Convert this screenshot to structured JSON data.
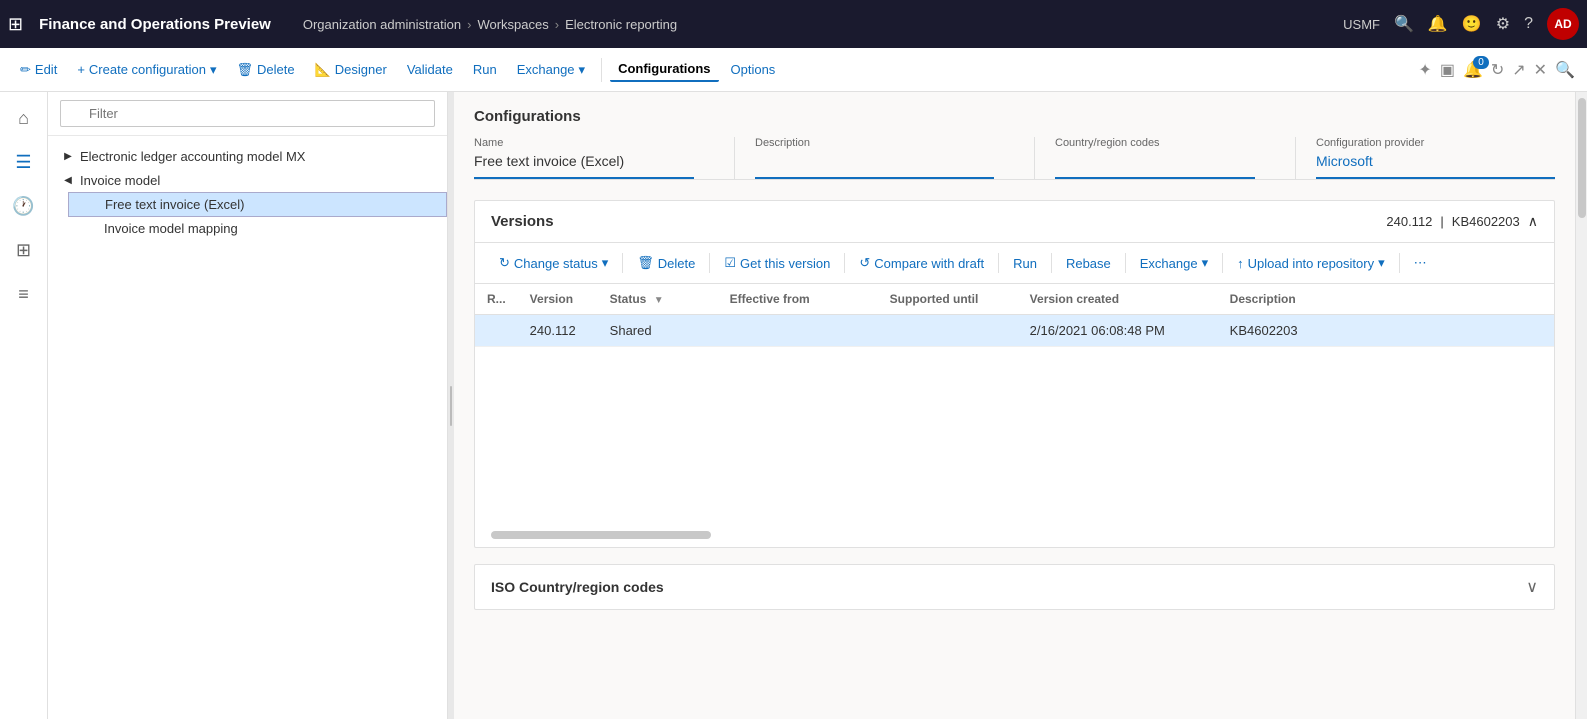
{
  "app": {
    "title": "Finance and Operations Preview",
    "tenant": "USMF",
    "avatar": "AD"
  },
  "breadcrumb": {
    "items": [
      "Organization administration",
      "Workspaces",
      "Electronic reporting"
    ]
  },
  "toolbar": {
    "buttons": [
      {
        "id": "edit",
        "label": "Edit",
        "icon": "✏️"
      },
      {
        "id": "create-config",
        "label": "Create configuration",
        "icon": "+",
        "dropdown": true
      },
      {
        "id": "delete",
        "label": "Delete",
        "icon": "🗑"
      },
      {
        "id": "designer",
        "label": "Designer",
        "icon": "📐"
      },
      {
        "id": "validate",
        "label": "Validate"
      },
      {
        "id": "run",
        "label": "Run"
      },
      {
        "id": "exchange",
        "label": "Exchange",
        "dropdown": true
      },
      {
        "id": "configurations",
        "label": "Configurations",
        "active": true
      },
      {
        "id": "options",
        "label": "Options"
      }
    ]
  },
  "filter": {
    "placeholder": "Filter"
  },
  "tree": {
    "items": [
      {
        "id": "electronic-ledger",
        "label": "Electronic ledger accounting model MX",
        "indent": 0,
        "collapsed": true
      },
      {
        "id": "invoice-model",
        "label": "Invoice model",
        "indent": 0,
        "expanded": true
      },
      {
        "id": "free-text-excel",
        "label": "Free text invoice (Excel)",
        "indent": 1,
        "selected": true
      },
      {
        "id": "invoice-model-mapping",
        "label": "Invoice model mapping",
        "indent": 1
      }
    ]
  },
  "configurations": {
    "title": "Configurations",
    "fields": [
      {
        "label": "Name",
        "value": "Free text invoice (Excel)",
        "type": "text"
      },
      {
        "label": "Description",
        "value": "",
        "type": "text"
      },
      {
        "label": "Country/region codes",
        "value": "",
        "type": "text"
      },
      {
        "label": "Configuration provider",
        "value": "Microsoft",
        "type": "link"
      }
    ]
  },
  "versions": {
    "title": "Versions",
    "meta_version": "240.112",
    "meta_kb": "KB4602203",
    "actions": [
      {
        "id": "change-status",
        "label": "Change status",
        "icon": "↻",
        "dropdown": true,
        "disabled": false
      },
      {
        "id": "delete",
        "label": "Delete",
        "icon": "🗑",
        "disabled": false
      },
      {
        "id": "get-this-version",
        "label": "Get this version",
        "icon": "☑",
        "disabled": false
      },
      {
        "id": "compare-draft",
        "label": "Compare with draft",
        "icon": "↺",
        "disabled": false
      },
      {
        "id": "run",
        "label": "Run",
        "disabled": false
      },
      {
        "id": "rebase",
        "label": "Rebase",
        "disabled": false
      },
      {
        "id": "exchange",
        "label": "Exchange",
        "dropdown": true,
        "disabled": false
      },
      {
        "id": "upload-repo",
        "label": "Upload into repository",
        "icon": "↑",
        "dropdown": true,
        "disabled": false
      },
      {
        "id": "more",
        "label": "⋯",
        "disabled": false
      }
    ],
    "table": {
      "columns": [
        {
          "id": "r",
          "label": "R..."
        },
        {
          "id": "version",
          "label": "Version"
        },
        {
          "id": "status",
          "label": "Status",
          "filter": true
        },
        {
          "id": "effective-from",
          "label": "Effective from"
        },
        {
          "id": "supported-until",
          "label": "Supported until"
        },
        {
          "id": "version-created",
          "label": "Version created"
        },
        {
          "id": "description",
          "label": "Description"
        }
      ],
      "rows": [
        {
          "r": "",
          "version": "240.112",
          "status": "Shared",
          "effective_from": "",
          "supported_until": "",
          "version_created": "2/16/2021 06:08:48 PM",
          "description": "KB4602203",
          "selected": true
        }
      ]
    }
  },
  "iso_section": {
    "title": "ISO Country/region codes"
  },
  "scrollbar": {
    "visible": true
  }
}
